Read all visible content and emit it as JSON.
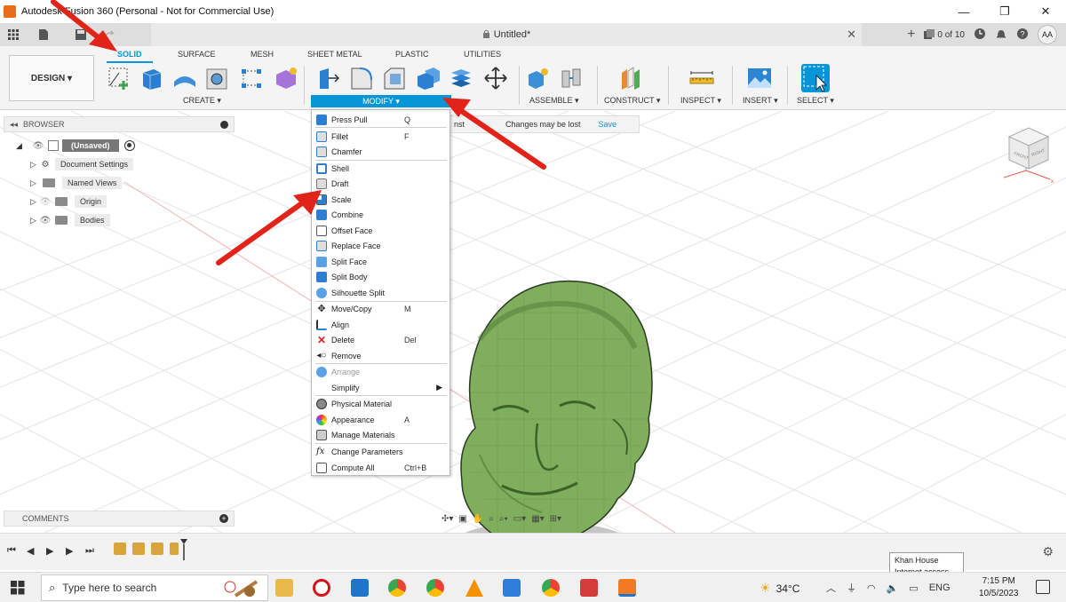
{
  "window": {
    "title": "Autodesk Fusion 360 (Personal - Not for Commercial Use)",
    "minimize": "—",
    "maximize": "❐",
    "close": "✕"
  },
  "quick_access": {
    "doc_title": "Untitled*",
    "lock_icon": "🔒",
    "close_tab": "✕",
    "jobs": "0 of 10",
    "avatar": "AA"
  },
  "ribbon": {
    "workspace": "DESIGN ▾",
    "tabs": [
      "SOLID",
      "SURFACE",
      "MESH",
      "SHEET METAL",
      "PLASTIC",
      "UTILITIES"
    ],
    "groups": {
      "create": "CREATE ▾",
      "modify": "MODIFY ▾",
      "assemble": "ASSEMBLE ▾",
      "construct": "CONSTRUCT ▾",
      "inspect": "INSPECT ▾",
      "insert": "INSERT ▾",
      "select": "SELECT ▾"
    }
  },
  "browser": {
    "header": "BROWSER",
    "collapse": "◂◂",
    "root": "(Unsaved)",
    "items": [
      "Document Settings",
      "Named Views",
      "Origin",
      "Bodies"
    ]
  },
  "changes_bar": {
    "message": "Changes may be lost",
    "save": "Save",
    "prefix": "nst"
  },
  "modify_menu": {
    "items": [
      {
        "label": "Press Pull",
        "shortcut": "Q"
      },
      {
        "label": "Fillet",
        "shortcut": "F"
      },
      {
        "label": "Chamfer",
        "shortcut": ""
      },
      {
        "label": "Shell",
        "shortcut": ""
      },
      {
        "label": "Draft",
        "shortcut": ""
      },
      {
        "label": "Scale",
        "shortcut": ""
      },
      {
        "label": "Combine",
        "shortcut": ""
      },
      {
        "label": "Offset Face",
        "shortcut": ""
      },
      {
        "label": "Replace Face",
        "shortcut": ""
      },
      {
        "label": "Split Face",
        "shortcut": ""
      },
      {
        "label": "Split Body",
        "shortcut": ""
      },
      {
        "label": "Silhouette Split",
        "shortcut": ""
      },
      {
        "label": "Move/Copy",
        "shortcut": "M"
      },
      {
        "label": "Align",
        "shortcut": ""
      },
      {
        "label": "Delete",
        "shortcut": "Del"
      },
      {
        "label": "Remove",
        "shortcut": ""
      },
      {
        "label": "Arrange",
        "shortcut": ""
      },
      {
        "label": "Simplify",
        "shortcut": "▶"
      },
      {
        "label": "Physical Material",
        "shortcut": ""
      },
      {
        "label": "Appearance",
        "shortcut": "A"
      },
      {
        "label": "Manage Materials",
        "shortcut": ""
      },
      {
        "label": "Change Parameters",
        "shortcut": ""
      },
      {
        "label": "Compute All",
        "shortcut": "Ctrl+B"
      }
    ]
  },
  "viewcube": {
    "front": "FRONT",
    "right": "RIGHT"
  },
  "comments": {
    "label": "COMMENTS",
    "add": "+"
  },
  "timeline": {
    "first": "⏮",
    "prev": "◀",
    "play": "▶",
    "next": "▶",
    "last": "⏭",
    "settings": "⚙"
  },
  "tooltip": {
    "line1": "Khan House",
    "line2": "Internet access"
  },
  "taskbar": {
    "search_placeholder": "Type here to search",
    "temperature": "34°C",
    "language": "ENG",
    "time": "7:15 PM",
    "date": "10/5/2023"
  },
  "colors": {
    "accent": "#0696d7",
    "head_green": "#7fae5c",
    "annotation_red": "#e2231a"
  }
}
